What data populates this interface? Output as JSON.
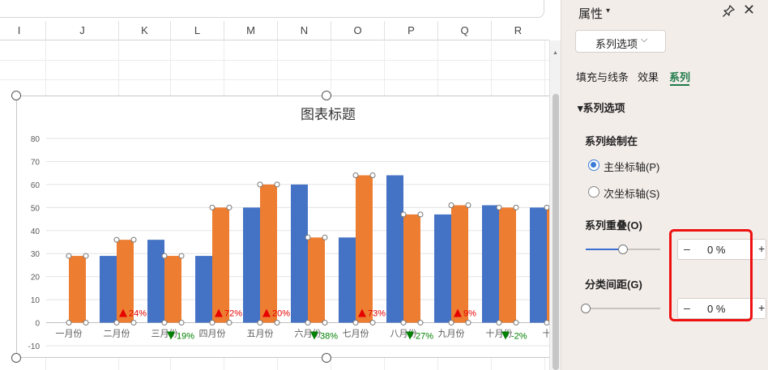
{
  "sheet": {
    "columns": [
      "I",
      "J",
      "K",
      "L",
      "M",
      "N",
      "O",
      "P",
      "Q",
      "R"
    ]
  },
  "chart_data": {
    "type": "bar",
    "title": "图表标题",
    "categories": [
      "一月份",
      "二月份",
      "三月份",
      "四月份",
      "五月份",
      "六月份",
      "七月份",
      "八月份",
      "九月份",
      "十月份",
      "十"
    ],
    "series": [
      {
        "values": [
          0,
          29,
          36,
          29,
          50,
          60,
          37,
          64,
          47,
          51,
          50
        ],
        "color": "#4472c4"
      },
      {
        "values": [
          29,
          36,
          29,
          50,
          60,
          37,
          64,
          47,
          51,
          50,
          50
        ],
        "color": "#ed7d31"
      }
    ],
    "ylim": [
      -10,
      80
    ],
    "yticks": [
      "80",
      "70",
      "60",
      "50",
      "40",
      "30",
      "20",
      "10",
      "0",
      "-10"
    ],
    "grid": true,
    "annotations": [
      {
        "category": "二月份",
        "text": "24%",
        "direction": "up",
        "color": "#e60000"
      },
      {
        "category": "三月份",
        "text": "19%",
        "direction": "down",
        "color": "#008000"
      },
      {
        "category": "四月份",
        "text": "72%",
        "direction": "up",
        "color": "#e60000"
      },
      {
        "category": "五月份",
        "text": "20%",
        "direction": "up",
        "color": "#e60000"
      },
      {
        "category": "六月份",
        "text": "38%",
        "direction": "down",
        "color": "#008000"
      },
      {
        "category": "七月份",
        "text": "73%",
        "direction": "up",
        "color": "#e60000"
      },
      {
        "category": "八月份",
        "text": "27%",
        "direction": "down",
        "color": "#008000"
      },
      {
        "category": "九月份",
        "text": "9%",
        "direction": "up",
        "color": "#e60000"
      },
      {
        "category": "十月份",
        "text": "-2%",
        "direction": "down",
        "color": "#008000"
      }
    ]
  },
  "panel": {
    "title": "属性",
    "title_caret": "▾",
    "close": "✕",
    "dropdown_label": "系列选项",
    "dropdown_chevron": "⌵",
    "tabs": [
      {
        "label": "填充与线条"
      },
      {
        "label": "效果"
      },
      {
        "label": "系列",
        "active": true
      }
    ],
    "section_title": "▾系列选项",
    "plot_on_title": "系列绘制在",
    "radio_primary": "主坐标轴(P)",
    "radio_secondary": "次坐标轴(S)",
    "overlap_title": "系列重叠(O)",
    "overlap_value": "0 %",
    "overlap_level": 0.5,
    "gap_title": "分类间距(G)",
    "gap_value": "0 %",
    "gap_level": 0,
    "minus": "–",
    "plus": "+"
  },
  "colors": {
    "accent_green": "#1f7a4a",
    "highlight_red": "#ee1111",
    "series1": "#4472c4",
    "series2": "#ed7d31"
  }
}
